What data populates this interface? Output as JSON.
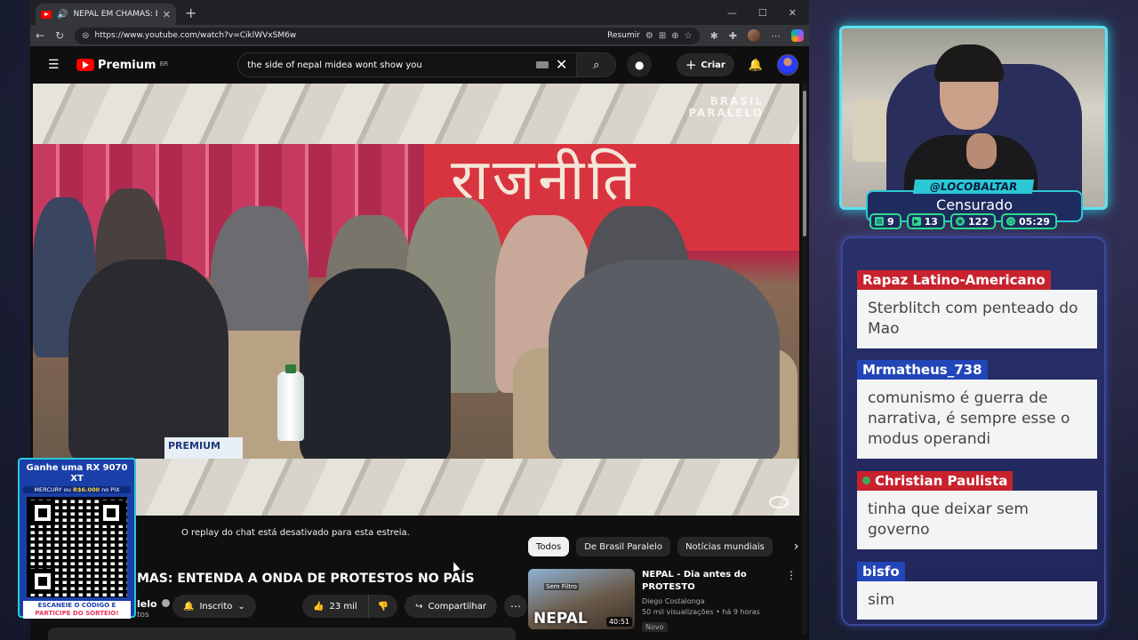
{
  "browser": {
    "tab_title": "NEPAL EM CHAMAS: ENTENDA",
    "url": "https://www.youtube.com/watch?v=CiklWVxSM6w",
    "resumir_label": "Resumir"
  },
  "youtube": {
    "logo_text": "Premium",
    "region": "BR",
    "search_value": "the side of nepal midea wont show you",
    "create_label": "Criar",
    "video": {
      "watermark_line1": "BRASIL",
      "watermark_line2": "PARALELO",
      "banner_text": "राजनीति",
      "premium_box_text": "PREMIUM"
    },
    "chat_replay_notice": "O replay do chat está desativado para esta estreia.",
    "video_title": "MAS: ENTENDA A ONDA DE PROTESTOS NO PAÍS",
    "channel_name": "lelo",
    "channel_subs": "tos",
    "subscribed_label": "Inscrito",
    "likes": "23 mil",
    "share_label": "Compartilhar",
    "chips": [
      "Todos",
      "De Brasil Paralelo",
      "Notícias mundiais"
    ],
    "recommendation": {
      "title": "NEPAL - Dia antes do PROTESTO",
      "channel": "Diego Costalonga",
      "meta": "50 mil visualizações • há 9 horas",
      "badge": "Novo",
      "duration": "40:51",
      "thumb_word": "NEPAL",
      "thumb_tag": "Sem Filtro"
    }
  },
  "qr_card": {
    "headline": "Ganhe uma RX 9070 XT",
    "sub_prefix": "MERCURY ou",
    "sub_amount": "R$6.000",
    "sub_suffix": "no PIX",
    "footer_line1": "ESCANEIE O CÓDIGO E",
    "footer_line2": "PARTICIPE DO SORTEIO!"
  },
  "stream": {
    "handle": "@LOCOBALTAR",
    "status": "Censurado",
    "stats": [
      {
        "icon": "chat-icon",
        "value": "9"
      },
      {
        "icon": "youtube-icon",
        "value": "13"
      },
      {
        "icon": "viewers-icon",
        "value": "122"
      },
      {
        "icon": "clock-icon",
        "value": "05:29"
      }
    ]
  },
  "chat": [
    {
      "user": "Rapaz Latino-Americano",
      "color": "#c8222e",
      "text": "Sterblitch com penteado do Mao"
    },
    {
      "user": "Mrmatheus_738",
      "color": "#2246b8",
      "text": "comunismo é guerra de narrativa, é sempre esse o modus operandi"
    },
    {
      "user": "Christian Paulista",
      "color": "#c8222e",
      "text": "tinha que deixar sem governo"
    },
    {
      "user": "bisfo",
      "color": "#2246b8",
      "text": "sim"
    }
  ]
}
